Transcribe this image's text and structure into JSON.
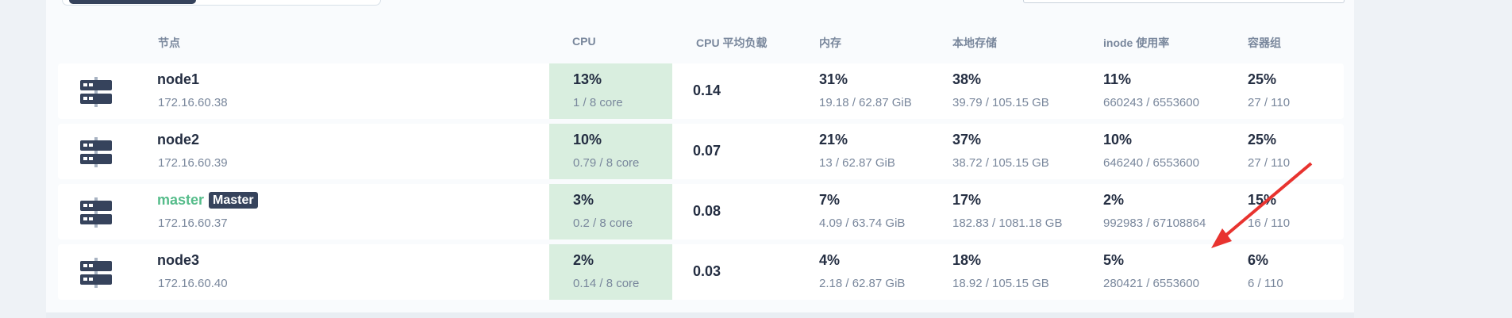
{
  "table": {
    "columns": {
      "node": "节点",
      "cpu": "CPU",
      "cpu_load": "CPU 平均负载",
      "memory": "内存",
      "storage": "本地存储",
      "inode": "inode 使用率",
      "pods": "容器组"
    },
    "rows": [
      {
        "name": "node1",
        "badge": "",
        "ip": "172.16.60.38",
        "cpu": "13%",
        "cpu_detail": "1 / 8 core",
        "load": "0.14",
        "mem": "31%",
        "mem_detail": "19.18 / 62.87 GiB",
        "disk": "38%",
        "disk_detail": "39.79 / 105.15 GB",
        "inode": "11%",
        "inode_detail": "660243 / 6553600",
        "pods": "25%",
        "pods_detail": "27 / 110"
      },
      {
        "name": "node2",
        "badge": "",
        "ip": "172.16.60.39",
        "cpu": "10%",
        "cpu_detail": "0.79 / 8 core",
        "load": "0.07",
        "mem": "21%",
        "mem_detail": "13 / 62.87 GiB",
        "disk": "37%",
        "disk_detail": "38.72 / 105.15 GB",
        "inode": "10%",
        "inode_detail": "646240 / 6553600",
        "pods": "25%",
        "pods_detail": "27 / 110"
      },
      {
        "name": "master",
        "badge": "Master",
        "ip": "172.16.60.37",
        "cpu": "3%",
        "cpu_detail": "0.2 / 8 core",
        "load": "0.08",
        "mem": "7%",
        "mem_detail": "4.09 / 63.74 GiB",
        "disk": "17%",
        "disk_detail": "182.83 / 1081.18 GB",
        "inode": "2%",
        "inode_detail": "992983 / 67108864",
        "pods": "15%",
        "pods_detail": "16 / 110"
      },
      {
        "name": "node3",
        "badge": "",
        "ip": "172.16.60.40",
        "cpu": "2%",
        "cpu_detail": "0.14 / 8 core",
        "load": "0.03",
        "mem": "4%",
        "mem_detail": "2.18 / 62.87 GiB",
        "disk": "18%",
        "disk_detail": "18.92 / 105.15 GB",
        "inode": "5%",
        "inode_detail": "280421 / 6553600",
        "pods": "6%",
        "pods_detail": "6 / 110"
      }
    ]
  },
  "colors": {
    "cpu_highlight": "#d9eedf",
    "master_name": "#55bc8a",
    "badge_bg": "#36435c",
    "annotation_arrow": "#e8332f"
  },
  "icons": {
    "node": "server-icon"
  }
}
